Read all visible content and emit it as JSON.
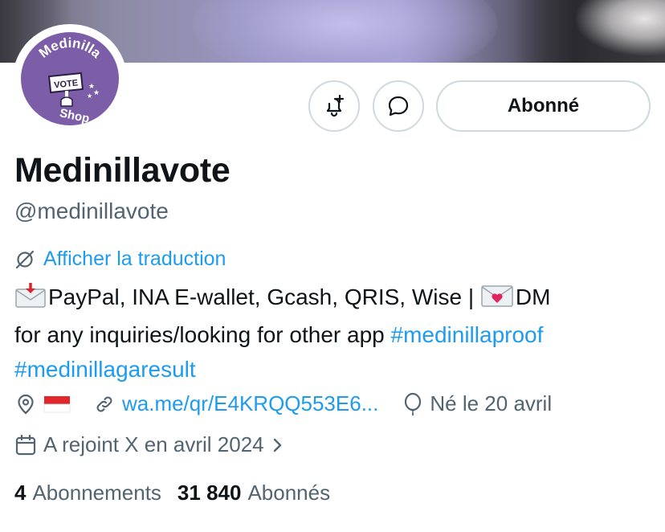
{
  "profile": {
    "display_name": "Medinillavote",
    "handle": "@medinillavote",
    "avatar_logo_text": [
      "Medinilla",
      "VOTE",
      "Shop"
    ]
  },
  "actions": {
    "follow_label": "Abonné",
    "notify_icon": "bell-plus-icon",
    "message_icon": "chat-bubble-icon"
  },
  "translate": {
    "label": "Afficher la traduction"
  },
  "bio": {
    "line1_text": "PayPal, INA E-wallet, Gcash, QRIS, Wise | ",
    "line1_after_emoji": "DM",
    "line2_text": "for any inquiries/looking for other app ",
    "hashtag1": "#medinillaproof",
    "hashtag2": "#medinillagaresult",
    "emoji1": "envelope-with-arrow-emoji",
    "emoji2": "love-letter-emoji"
  },
  "meta": {
    "location_flag": "indonesia-flag",
    "website": "wa.me/qr/E4KRQQ553E6...",
    "birthday": "Né le 20 avril",
    "joined": "A rejoint X en avril 2024"
  },
  "stats": {
    "following_count": "4",
    "following_label": "Abonnements",
    "followers_count": "31 840",
    "followers_label": "Abonnés"
  },
  "colors": {
    "link_blue": "#1d9bf0",
    "secondary_text": "#536471",
    "border": "#cfd9de",
    "avatar_purple": "#7b5ea7"
  }
}
